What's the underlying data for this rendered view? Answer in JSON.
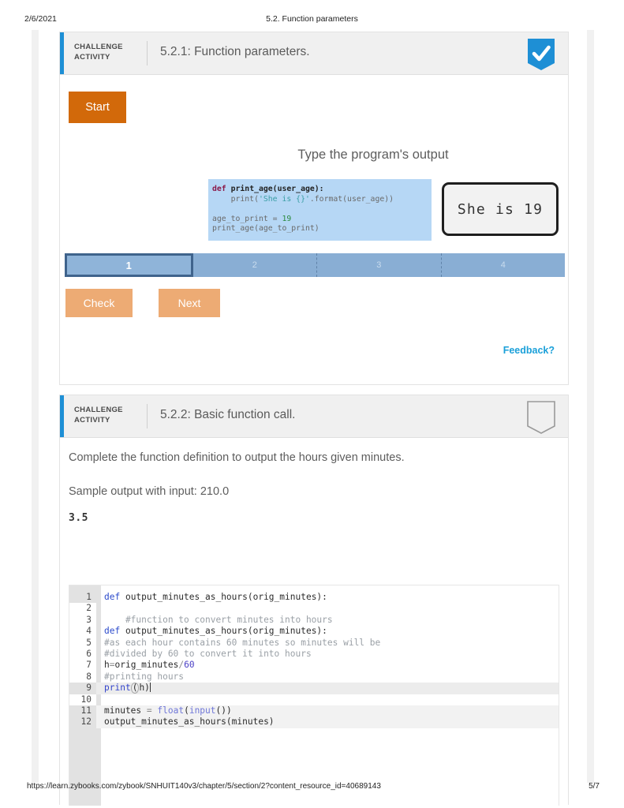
{
  "print": {
    "date": "2/6/2021",
    "title": "5.2. Function parameters",
    "url": "https://learn.zybooks.com/zybook/SNHUIT140v3/chapter/5/section/2?content_resource_id=40689143",
    "page": "5/7"
  },
  "activity1": {
    "kicker_line1": "CHALLENGE",
    "kicker_line2": "ACTIVITY",
    "title": "5.2.1: Function parameters.",
    "badge": "check-shield-filled",
    "start_label": "Start",
    "prompt": "Type the program's output",
    "code": {
      "l1_def": "def",
      "l1_name": " print_age(user_age)",
      "l1_colon": ":",
      "l2_pre": "    print(",
      "l2_str": "'She is {}'",
      "l2_post": ".format(user_age))",
      "l3": "",
      "l4_pre": "age_to_print = ",
      "l4_num": "19",
      "l5": "print_age(age_to_print)"
    },
    "answer_value": "She is 19",
    "steps": [
      "1",
      "2",
      "3",
      "4"
    ],
    "active_step": "1",
    "check_label": "Check",
    "next_label": "Next",
    "feedback_label": "Feedback?"
  },
  "activity2": {
    "kicker_line1": "CHALLENGE",
    "kicker_line2": "ACTIVITY",
    "title": "5.2.2: Basic function call.",
    "badge": "empty-shield-outline",
    "instruction": "Complete the function definition to output the hours given minutes.",
    "sample_label": "Sample output with input: 210.0",
    "sample_output": "3.5",
    "editor": {
      "lines": [
        {
          "n": "1",
          "editable": false,
          "readonly_body": false,
          "highlight": false,
          "parts": [
            {
              "t": "def",
              "c": "k-def"
            },
            {
              "t": " output_minutes_as_hours(orig_minutes):",
              "c": ""
            }
          ]
        },
        {
          "n": "2",
          "editable": true,
          "readonly_body": false,
          "highlight": false,
          "parts": []
        },
        {
          "n": "3",
          "editable": true,
          "readonly_body": false,
          "highlight": false,
          "parts": [
            {
              "t": "    #function to convert minutes into hours",
              "c": "k-cmt"
            }
          ]
        },
        {
          "n": "4",
          "editable": true,
          "readonly_body": false,
          "highlight": false,
          "parts": [
            {
              "t": "def",
              "c": "k-def"
            },
            {
              "t": " output_minutes_as_hours(orig_minutes):",
              "c": ""
            }
          ]
        },
        {
          "n": "5",
          "editable": true,
          "readonly_body": false,
          "highlight": false,
          "parts": [
            {
              "t": "#as each hour contains 60 minutes so minutes will be",
              "c": "k-cmt"
            }
          ]
        },
        {
          "n": "6",
          "editable": true,
          "readonly_body": false,
          "highlight": false,
          "parts": [
            {
              "t": "#divided by 60 to convert it into hours",
              "c": "k-cmt"
            }
          ]
        },
        {
          "n": "7",
          "editable": true,
          "readonly_body": false,
          "highlight": false,
          "parts": [
            {
              "t": "h",
              "c": ""
            },
            {
              "t": "=",
              "c": "k-op"
            },
            {
              "t": "orig_minutes",
              "c": ""
            },
            {
              "t": "/",
              "c": "k-op"
            },
            {
              "t": "60",
              "c": "k-num"
            }
          ]
        },
        {
          "n": "8",
          "editable": true,
          "readonly_body": false,
          "highlight": false,
          "parts": [
            {
              "t": "#printing hours",
              "c": "k-cmt"
            }
          ]
        },
        {
          "n": "9",
          "editable": true,
          "readonly_body": false,
          "highlight": true,
          "parts": [
            {
              "t": "print",
              "c": "k-print"
            }
          ],
          "paren_open": "(",
          "paren_rest": "h)",
          "caret": true
        },
        {
          "n": "10",
          "editable": true,
          "readonly_body": false,
          "highlight": false,
          "parts": []
        },
        {
          "n": "11",
          "editable": false,
          "readonly_body": true,
          "highlight": false,
          "parts": [
            {
              "t": "minutes ",
              "c": ""
            },
            {
              "t": "=",
              "c": "k-op"
            },
            {
              "t": " ",
              "c": ""
            },
            {
              "t": "float",
              "c": "k-fn"
            },
            {
              "t": "(",
              "c": ""
            },
            {
              "t": "input",
              "c": "k-fn"
            },
            {
              "t": "())",
              "c": ""
            }
          ]
        },
        {
          "n": "12",
          "editable": false,
          "readonly_body": true,
          "highlight": false,
          "parts": [
            {
              "t": "output_minutes_as_hours(minutes)",
              "c": ""
            }
          ]
        }
      ]
    }
  },
  "colors": {
    "accent_blue": "#1e8fd5",
    "start_orange": "#d2690a",
    "button_orange": "#edab74",
    "progress_blue": "#89aed4",
    "progress_active_border": "#3f638c",
    "snippet_bg": "#b6d7f5",
    "link_blue": "#1ba0d9"
  }
}
